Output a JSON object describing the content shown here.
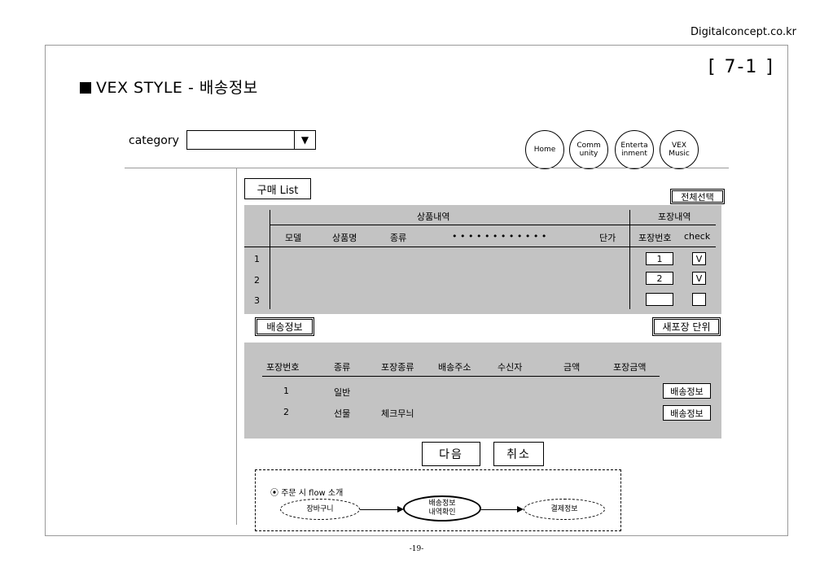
{
  "site_label": "Digitalconcept.co.kr",
  "page_title": "VEX STYLE - 배송정보",
  "page_number": "[ 7-1 ]",
  "category": {
    "label": "category",
    "value": "",
    "arrow": "▼"
  },
  "nav": [
    {
      "lines": [
        "Home"
      ]
    },
    {
      "lines": [
        "Comm",
        "unity"
      ]
    },
    {
      "lines": [
        "Enterta",
        "inment"
      ]
    },
    {
      "lines": [
        "VEX",
        "Music"
      ]
    }
  ],
  "purchase": {
    "list_button": "구매 List",
    "select_all": "전체선택",
    "group_product": "상품내역",
    "group_package": "포장내역",
    "cols": {
      "model": "모델",
      "name": "상품명",
      "kind": "종류",
      "dots": "• • • • • • • • • • • •",
      "price": "단가",
      "pack_no": "포장번호",
      "check": "check"
    },
    "rows": [
      {
        "num": "1",
        "pack_no": "1",
        "check": "V"
      },
      {
        "num": "2",
        "pack_no": "2",
        "check": "V"
      },
      {
        "num": "3",
        "pack_no": "",
        "check": ""
      }
    ],
    "shipping_button": "배송정보",
    "new_pack_button": "새포장 단위"
  },
  "shipping": {
    "headers": [
      "포장번호",
      "종류",
      "포장종류",
      "배송주소",
      "수신자",
      "금액",
      "포장금액"
    ],
    "rows": [
      {
        "no": "1",
        "kind": "일반",
        "pack_kind": "",
        "button": "배송정보"
      },
      {
        "no": "2",
        "kind": "선물",
        "pack_kind": "체크무늬",
        "button": "배송정보"
      }
    ]
  },
  "actions": {
    "next": "다음",
    "cancel": "취소"
  },
  "flow": {
    "title": "주문 시 flow 소개",
    "marker": "⦿",
    "steps": [
      "장바구니",
      "배송정보",
      "내역확인",
      "결제정보"
    ]
  },
  "footer": "-19-"
}
